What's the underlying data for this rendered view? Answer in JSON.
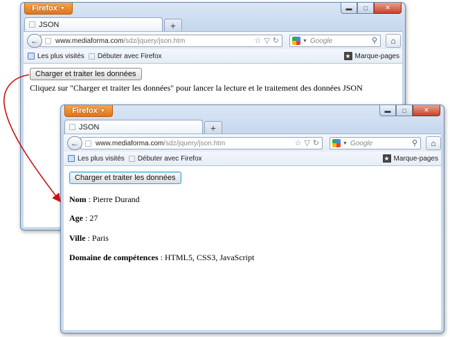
{
  "browser": {
    "menu_button": "Firefox",
    "tab_title": "JSON",
    "url_host": "www.mediaforma.com",
    "url_path": "/sdz/jquery/json.htm",
    "search_placeholder": "Google",
    "bookmarks": [
      "Les plus visités",
      "Débuter avec Firefox"
    ],
    "bookmarks_menu": "Marque-pages"
  },
  "window1": {
    "load_button": "Charger et traiter les données",
    "instruction": "Cliquez sur \"Charger et traiter les données\" pour lancer la lecture et le traitement des données JSON"
  },
  "window2": {
    "load_button": "Charger et traiter les données",
    "fields": [
      {
        "label": "Nom",
        "value": " : Pierre Durand"
      },
      {
        "label": "Age",
        "value": " : 27"
      },
      {
        "label": "Ville",
        "value": " : Paris"
      },
      {
        "label": "Domaine de compétences",
        "value": " : HTML5, CSS3, JavaScript"
      }
    ]
  },
  "colors": {
    "firefox_orange": "#e0751c",
    "arrow": "#cc1111"
  },
  "icons": [
    "firefox-menu-caret-icon",
    "tab-favicon-icon",
    "new-tab-icon",
    "back-arrow-icon",
    "bookmark-star-icon",
    "reload-icon",
    "google-icon",
    "search-icon",
    "home-icon",
    "bookmarks-star-icon"
  ]
}
